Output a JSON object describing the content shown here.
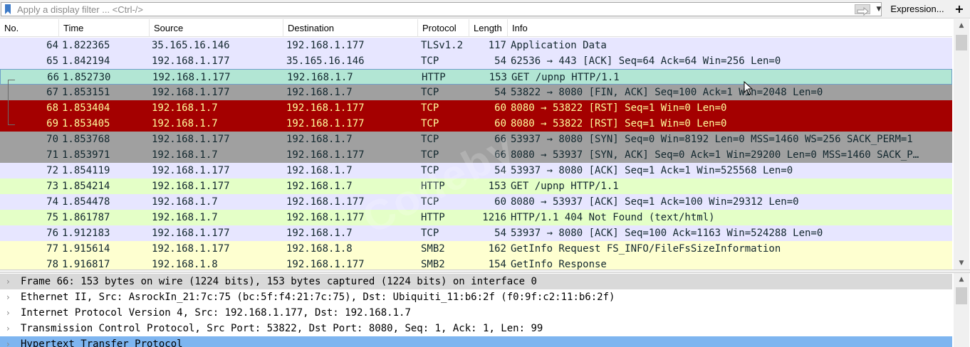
{
  "filter": {
    "placeholder": "Apply a display filter ... <Ctrl-/>",
    "expression_label": "Expression...",
    "add_label": "+"
  },
  "columns": [
    "No.",
    "Time",
    "Source",
    "Destination",
    "Protocol",
    "Length",
    "Info"
  ],
  "packets": [
    {
      "no": "64",
      "time": "1.822365",
      "src": "35.165.16.146",
      "dst": "192.168.1.177",
      "proto": "TLSv1.2",
      "len": "117",
      "info": "Application Data",
      "bg": "#e7e6ff",
      "fg": "#12272e"
    },
    {
      "no": "65",
      "time": "1.842194",
      "src": "192.168.1.177",
      "dst": "35.165.16.146",
      "proto": "TCP",
      "len": "54",
      "info": "62536 → 443 [ACK] Seq=64 Ack=64 Win=256 Len=0",
      "bg": "#e7e6ff",
      "fg": "#12272e"
    },
    {
      "no": "66",
      "time": "1.852730",
      "src": "192.168.1.177",
      "dst": "192.168.1.7",
      "proto": "HTTP",
      "len": "153",
      "info": "GET /upnp HTTP/1.1",
      "bg": "#b2e6d4",
      "fg": "#12272e"
    },
    {
      "no": "67",
      "time": "1.853151",
      "src": "192.168.1.177",
      "dst": "192.168.1.7",
      "proto": "TCP",
      "len": "54",
      "info": "53822 → 8080 [FIN, ACK] Seq=100 Ack=1 Win=2048 Len=0",
      "bg": "#a0a0a0",
      "fg": "#12272e"
    },
    {
      "no": "68",
      "time": "1.853404",
      "src": "192.168.1.7",
      "dst": "192.168.1.177",
      "proto": "TCP",
      "len": "60",
      "info": "8080 → 53822 [RST] Seq=1 Win=0 Len=0",
      "bg": "#a40000",
      "fg": "#fffc9c"
    },
    {
      "no": "69",
      "time": "1.853405",
      "src": "192.168.1.7",
      "dst": "192.168.1.177",
      "proto": "TCP",
      "len": "60",
      "info": "8080 → 53822 [RST] Seq=1 Win=0 Len=0",
      "bg": "#a40000",
      "fg": "#fffc9c"
    },
    {
      "no": "70",
      "time": "1.853768",
      "src": "192.168.1.177",
      "dst": "192.168.1.7",
      "proto": "TCP",
      "len": "66",
      "info": "53937 → 8080 [SYN] Seq=0 Win=8192 Len=0 MSS=1460 WS=256 SACK_PERM=1",
      "bg": "#a0a0a0",
      "fg": "#12272e"
    },
    {
      "no": "71",
      "time": "1.853971",
      "src": "192.168.1.7",
      "dst": "192.168.1.177",
      "proto": "TCP",
      "len": "66",
      "info": "8080 → 53937 [SYN, ACK] Seq=0 Ack=1 Win=29200 Len=0 MSS=1460 SACK_P…",
      "bg": "#a0a0a0",
      "fg": "#12272e"
    },
    {
      "no": "72",
      "time": "1.854119",
      "src": "192.168.1.177",
      "dst": "192.168.1.7",
      "proto": "TCP",
      "len": "54",
      "info": "53937 → 8080 [ACK] Seq=1 Ack=1 Win=525568 Len=0",
      "bg": "#e7e6ff",
      "fg": "#12272e"
    },
    {
      "no": "73",
      "time": "1.854214",
      "src": "192.168.1.177",
      "dst": "192.168.1.7",
      "proto": "HTTP",
      "len": "153",
      "info": "GET /upnp HTTP/1.1",
      "bg": "#e4ffc7",
      "fg": "#12272e"
    },
    {
      "no": "74",
      "time": "1.854478",
      "src": "192.168.1.7",
      "dst": "192.168.1.177",
      "proto": "TCP",
      "len": "60",
      "info": "8080 → 53937 [ACK] Seq=1 Ack=100 Win=29312 Len=0",
      "bg": "#e7e6ff",
      "fg": "#12272e"
    },
    {
      "no": "75",
      "time": "1.861787",
      "src": "192.168.1.7",
      "dst": "192.168.1.177",
      "proto": "HTTP",
      "len": "1216",
      "info": "HTTP/1.1 404 Not Found  (text/html)",
      "bg": "#e4ffc7",
      "fg": "#12272e"
    },
    {
      "no": "76",
      "time": "1.912183",
      "src": "192.168.1.177",
      "dst": "192.168.1.7",
      "proto": "TCP",
      "len": "54",
      "info": "53937 → 8080 [ACK] Seq=100 Ack=1163 Win=524288 Len=0",
      "bg": "#e7e6ff",
      "fg": "#12272e"
    },
    {
      "no": "77",
      "time": "1.915614",
      "src": "192.168.1.177",
      "dst": "192.168.1.8",
      "proto": "SMB2",
      "len": "162",
      "info": "GetInfo Request FS_INFO/FileFsSizeInformation",
      "bg": "#feffd0",
      "fg": "#12272e"
    },
    {
      "no": "78",
      "time": "1.916817",
      "src": "192.168.1.8",
      "dst": "192.168.1.177",
      "proto": "SMB2",
      "len": "154",
      "info": "GetInfo Response",
      "bg": "#feffd0",
      "fg": "#12272e"
    }
  ],
  "selected_packet": "66",
  "details": [
    {
      "text": "Frame 66: 153 bytes on wire (1224 bits), 153 bytes captured (1224 bits) on interface 0",
      "bg": "#d9d9d9"
    },
    {
      "text": "Ethernet II, Src: AsrockIn_21:7c:75 (bc:5f:f4:21:7c:75), Dst: Ubiquiti_11:b6:2f (f0:9f:c2:11:b6:2f)",
      "bg": "#ffffff"
    },
    {
      "text": "Internet Protocol Version 4, Src: 192.168.1.177, Dst: 192.168.1.7",
      "bg": "#ffffff"
    },
    {
      "text": "Transmission Control Protocol, Src Port: 53822, Dst Port: 8080, Seq: 1, Ack: 1, Len: 99",
      "bg": "#ffffff"
    },
    {
      "text": "Hypertext Transfer Protocol",
      "bg": "#7eb5f0"
    }
  ],
  "icons": {
    "bookmark": "bookmark-icon",
    "apply": "arrow-right-icon",
    "expander": "chevron-right-icon"
  },
  "watermark": "Codeby"
}
